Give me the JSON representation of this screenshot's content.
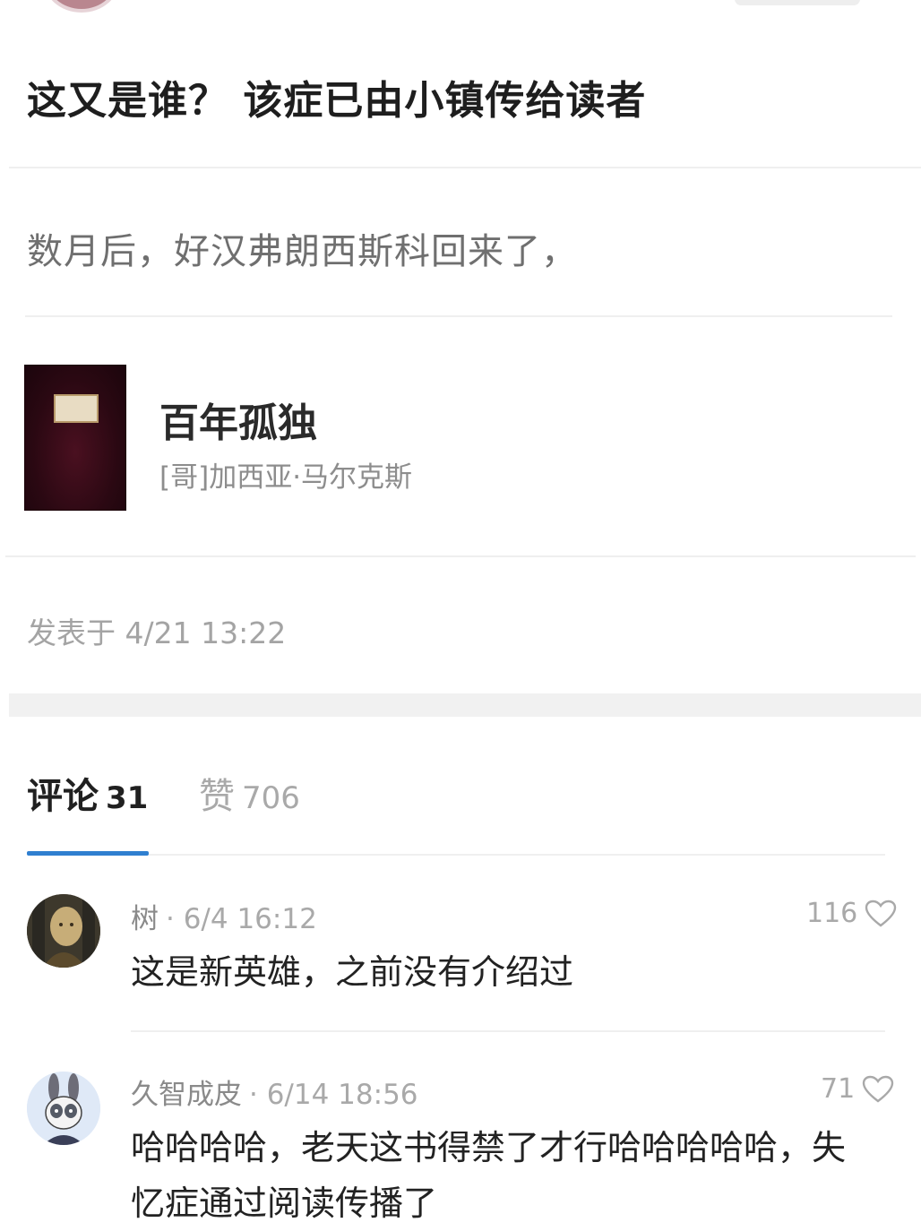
{
  "post": {
    "question": "这又是谁？ 该症已由小镇传给读者",
    "excerpt": "数月后，好汉弗朗西斯科回来了，",
    "book": {
      "title": "百年孤独",
      "author": "[哥]加西亚·马尔克斯"
    },
    "posted_label": "发表于 4/21 13:22"
  },
  "tabs": {
    "comments": {
      "label": "评论",
      "count": "31"
    },
    "likes": {
      "label": "赞",
      "count": "706"
    }
  },
  "comments": [
    {
      "name": "树",
      "time": "· 6/4 16:12",
      "likes": "116",
      "text": "这是新英雄，之前没有介绍过",
      "avatar_icon": "avatar-portrait"
    },
    {
      "name": "久智成皮",
      "time": "· 6/14 18:56",
      "likes": "71",
      "text": "哈哈哈哈，老天这书得禁了才行哈哈哈哈哈，失忆症通过阅读传播了",
      "avatar_icon": "avatar-rabbit"
    }
  ],
  "colors": {
    "tab_indicator": "#2f7fd0",
    "section_gap": "#f1f1f1",
    "book_cover": "#2a0812"
  }
}
